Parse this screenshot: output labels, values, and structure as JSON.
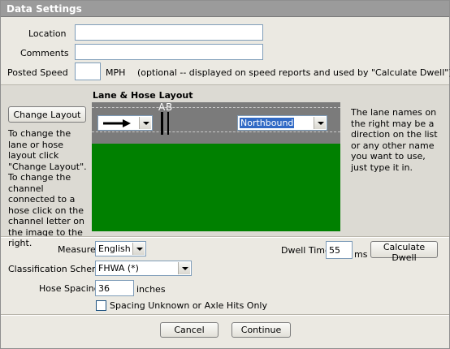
{
  "window": {
    "title": "Data Settings"
  },
  "fields": {
    "location_label": "Location",
    "location_value": "",
    "comments_label": "Comments",
    "comments_value": "",
    "posted_speed_label": "Posted Speed",
    "posted_speed_value": "",
    "posted_speed_unit": "MPH",
    "posted_speed_note": "(optional -- displayed on speed reports and used by \"Calculate Dwell\")"
  },
  "layout_section": {
    "heading": "Lane & Hose Layout",
    "change_layout_button": "Change Layout",
    "left_help": "To change the lane or hose layout click \"Change Layout\". To change the channel connected to a hose click on the channel letter on the image to the right.",
    "right_help": "The lane names on the right may be a direction on the list or any other name you want to use, just type it in.",
    "channel_labels": [
      "A",
      "B"
    ],
    "lane_direction_icon": "right-arrow-icon",
    "lane_name_value": "Northbound",
    "colors": {
      "road": "#7b7b7b",
      "grass": "#008000",
      "selection": "#316ac5"
    }
  },
  "settings": {
    "measure_label": "Measure",
    "measure_value": "English",
    "classification_label": "Classification Scheme",
    "classification_value": "FHWA (*)",
    "hose_spacing_label": "Hose Spacing",
    "hose_spacing_value": "36",
    "hose_spacing_unit": "inches",
    "spacing_unknown_label": "Spacing Unknown or Axle Hits Only",
    "spacing_unknown_checked": false,
    "dwell_time_label": "Dwell Time",
    "dwell_time_value": "55",
    "dwell_time_unit": "ms",
    "calculate_dwell_button": "Calculate Dwell"
  },
  "footer": {
    "cancel_button": "Cancel",
    "continue_button": "Continue"
  }
}
